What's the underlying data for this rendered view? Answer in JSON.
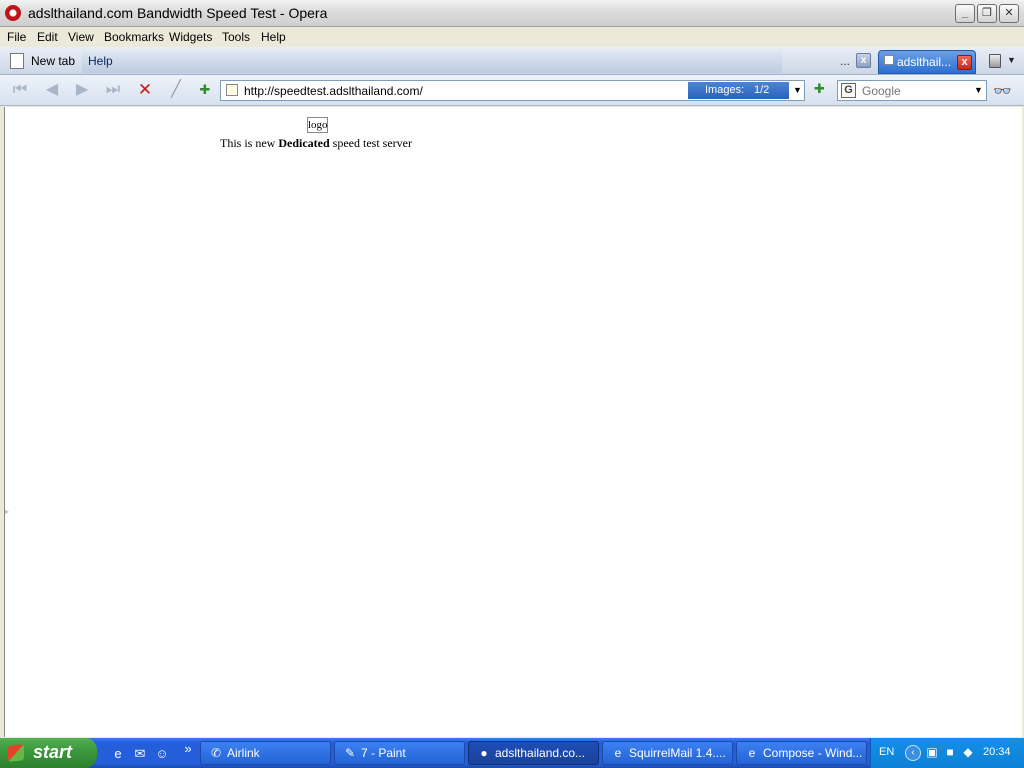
{
  "window": {
    "title": "adslthailand.com Bandwidth Speed Test - Opera",
    "min_glyph": "_",
    "max_glyph": "❐",
    "close_glyph": "✕"
  },
  "menu": {
    "items": [
      "File",
      "Edit",
      "View",
      "Bookmarks",
      "Widgets",
      "Tools",
      "Help"
    ]
  },
  "tabs": {
    "new_tab_label": "New tab",
    "help_tab_label": "Help",
    "overflow": "...",
    "inactive_close": "x",
    "active_tab_label": "adslthail...",
    "active_close": "x"
  },
  "toolbar": {
    "address": "http://speedtest.adslthailand.com/",
    "images_label": "Images:",
    "images_value": "1/2",
    "search_engine": "G",
    "search_placeholder": "Google",
    "icons": {
      "rewind": "⏮",
      "back": "◀",
      "forward": "▶",
      "fastforward": "⏭",
      "stop": "✕",
      "edit": "╱",
      "bookmark": "✚",
      "dropdown": "▼",
      "glasses": "👓"
    }
  },
  "page": {
    "logo_alt": "logo",
    "intro_prefix": "This is new ",
    "intro_bold": "Dedicated",
    "intro_suffix": " speed test server"
  },
  "taskbar": {
    "start_label": "start",
    "quick_more": "»",
    "tasks": [
      {
        "label": "Airlink",
        "icon": "airlink-icon"
      },
      {
        "label": "7 - Paint",
        "icon": "paint-icon"
      },
      {
        "label": "adslthailand.co...",
        "icon": "opera-icon",
        "active": true
      },
      {
        "label": "SquirrelMail 1.4....",
        "icon": "ie-icon"
      },
      {
        "label": "Compose - Wind...",
        "icon": "ie-icon"
      }
    ],
    "tray": {
      "language": "EN",
      "expand_glyph": "‹",
      "clock": "20:34"
    }
  },
  "colors": {
    "taskbar_blue": "#245edb",
    "start_green": "#3c9a3c",
    "active_tab_blue": "#2f6fd0",
    "stop_red": "#c21c14"
  }
}
